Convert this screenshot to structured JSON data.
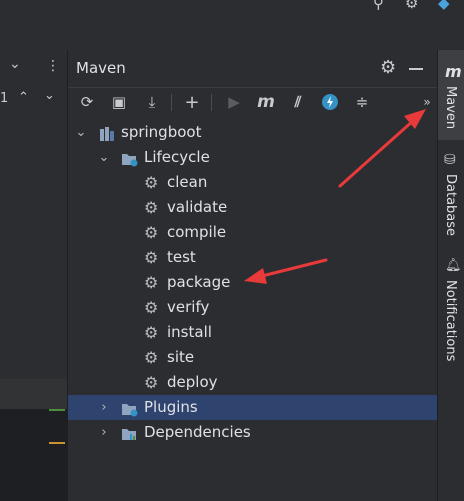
{
  "top_bar": {
    "icons": [
      "search-icon",
      "gear-icon",
      "logo-icon"
    ]
  },
  "left_strip": {
    "line_marker": "1",
    "icons": [
      "chevron-down-icon",
      "more-vert-icon",
      "caret-up-icon",
      "caret-down-icon"
    ]
  },
  "panel": {
    "title": "Maven",
    "header_icons": [
      "gear-icon",
      "minimize-icon"
    ],
    "toolbar": [
      {
        "name": "reload-icon",
        "glyph": "⟳"
      },
      {
        "name": "generate-sources-icon",
        "glyph": "▣"
      },
      {
        "name": "download-icon",
        "glyph": "⤓"
      },
      {
        "name": "add-icon",
        "glyph": "+"
      },
      {
        "name": "run-icon",
        "glyph": "▶"
      },
      {
        "name": "execute-goal-icon",
        "glyph": "m"
      },
      {
        "name": "toggle-offline-icon",
        "glyph": "⫽"
      },
      {
        "name": "skip-tests-icon",
        "glyph": "ϟ"
      },
      {
        "name": "collapse-all-icon",
        "glyph": "≑"
      },
      {
        "name": "more-icon",
        "glyph": "»"
      }
    ]
  },
  "tree": {
    "root": "springboot",
    "lifecycle": "Lifecycle",
    "goals": [
      "clean",
      "validate",
      "compile",
      "test",
      "package",
      "verify",
      "install",
      "site",
      "deploy"
    ],
    "plugins": "Plugins",
    "dependencies": "Dependencies",
    "selected": "Plugins"
  },
  "right_bar": {
    "tabs": [
      {
        "label": "Maven",
        "icon": "maven-icon",
        "active": true
      },
      {
        "label": "Database",
        "icon": "database-icon",
        "active": false
      },
      {
        "label": "Notifications",
        "icon": "bell-icon",
        "active": false
      }
    ]
  },
  "colors": {
    "background": "#2b2d30",
    "selection": "#2e436e",
    "text": "#dfe1e5",
    "annotation_arrow": "#e83a3a",
    "run_icon": "#5a5d62",
    "skip_tests_icon": "#3592c4",
    "folder_icon": "#8fa4bf"
  }
}
